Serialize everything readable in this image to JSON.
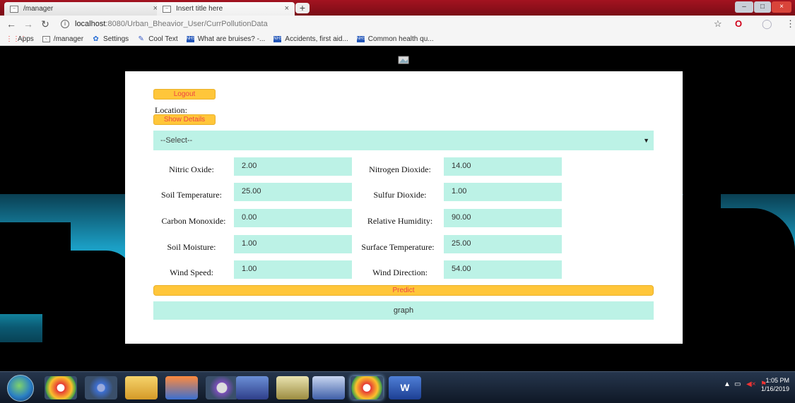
{
  "browser": {
    "tabs": [
      {
        "title": "/manager"
      },
      {
        "title": "Insert title here"
      }
    ],
    "new_tab": "+",
    "url": {
      "host": "localhost",
      "path": ":8080/Urban_Bheavior_User/CurrPollutionData"
    },
    "bookmarks": [
      {
        "label": "Apps"
      },
      {
        "label": "/manager"
      },
      {
        "label": "Settings"
      },
      {
        "label": "Cool Text"
      },
      {
        "label": "What are bruises? -..."
      },
      {
        "label": "Accidents, first aid..."
      },
      {
        "label": "Common health qu..."
      }
    ]
  },
  "page": {
    "logout_label": "Logout",
    "location_label": "Location:",
    "show_details_label": "Show Details",
    "select_value": "--Select--",
    "fields": [
      {
        "label": "Nitric Oxide:",
        "value": "2.00"
      },
      {
        "label": "Nitrogen Dioxide:",
        "value": "14.00"
      },
      {
        "label": "Soil Temperature:",
        "value": "25.00"
      },
      {
        "label": "Sulfur Dioxide:",
        "value": "1.00"
      },
      {
        "label": "Carbon Monoxide:",
        "value": "0.00"
      },
      {
        "label": "Relative Humidity:",
        "value": "90.00"
      },
      {
        "label": "Soil Moisture:",
        "value": "1.00"
      },
      {
        "label": "Surface Temperature:",
        "value": "25.00"
      },
      {
        "label": "Wind Speed:",
        "value": "1.00"
      },
      {
        "label": "Wind Direction:",
        "value": "54.00"
      }
    ],
    "predict_label": "Predict",
    "graph_label": "graph"
  },
  "taskbar": {
    "time": "1:05 PM",
    "date": "1/16/2019"
  },
  "colors": {
    "accent_yellow": "#ffc63a",
    "field_mint": "#bcf2e6",
    "button_text": "#e44444",
    "chrome_red": "#a31320"
  }
}
